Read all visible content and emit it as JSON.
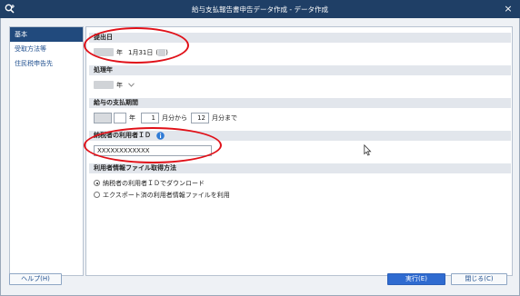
{
  "window": {
    "title": "給与支払報告書申告データ作成 - データ作成",
    "close_glyph": "×"
  },
  "sidebar": {
    "items": [
      {
        "label": "基本"
      },
      {
        "label": "受取方法等"
      },
      {
        "label": "住民税申告先"
      }
    ]
  },
  "sections": {
    "submission_date": {
      "header": "提出日",
      "year_suffix": "年",
      "month_day": "1月31日",
      "weekday_open": "(",
      "weekday_close": ")"
    },
    "processing_year": {
      "header": "処理年",
      "year_suffix": "年"
    },
    "payment_period": {
      "header": "給与の支払期間",
      "year_suffix": "年",
      "start_month": "1",
      "start_suffix": "月分から",
      "end_month": "12",
      "end_suffix": "月分まで"
    },
    "user_id": {
      "header": "納税者の利用者ＩＤ",
      "value": "XXXXXXXXXXXX"
    },
    "user_info_method": {
      "header": "利用者情報ファイル取得方法",
      "options": [
        {
          "label": "納税者の利用者ＩＤでダウンロード",
          "selected": true
        },
        {
          "label": "エクスポート済の利用者情報ファイルを利用",
          "selected": false
        }
      ]
    }
  },
  "buttons": {
    "help": "ヘルプ(H)",
    "run": "実行(E)",
    "close": "閉じる(C)"
  },
  "colors": {
    "titlebar": "#1f3f66",
    "accent": "#214a7d",
    "annotation": "#e01018",
    "primary_button": "#2f6bd0"
  },
  "icons": {
    "app": "app-search-icon",
    "info": "info-icon",
    "cursor": "mouse-pointer-icon"
  }
}
